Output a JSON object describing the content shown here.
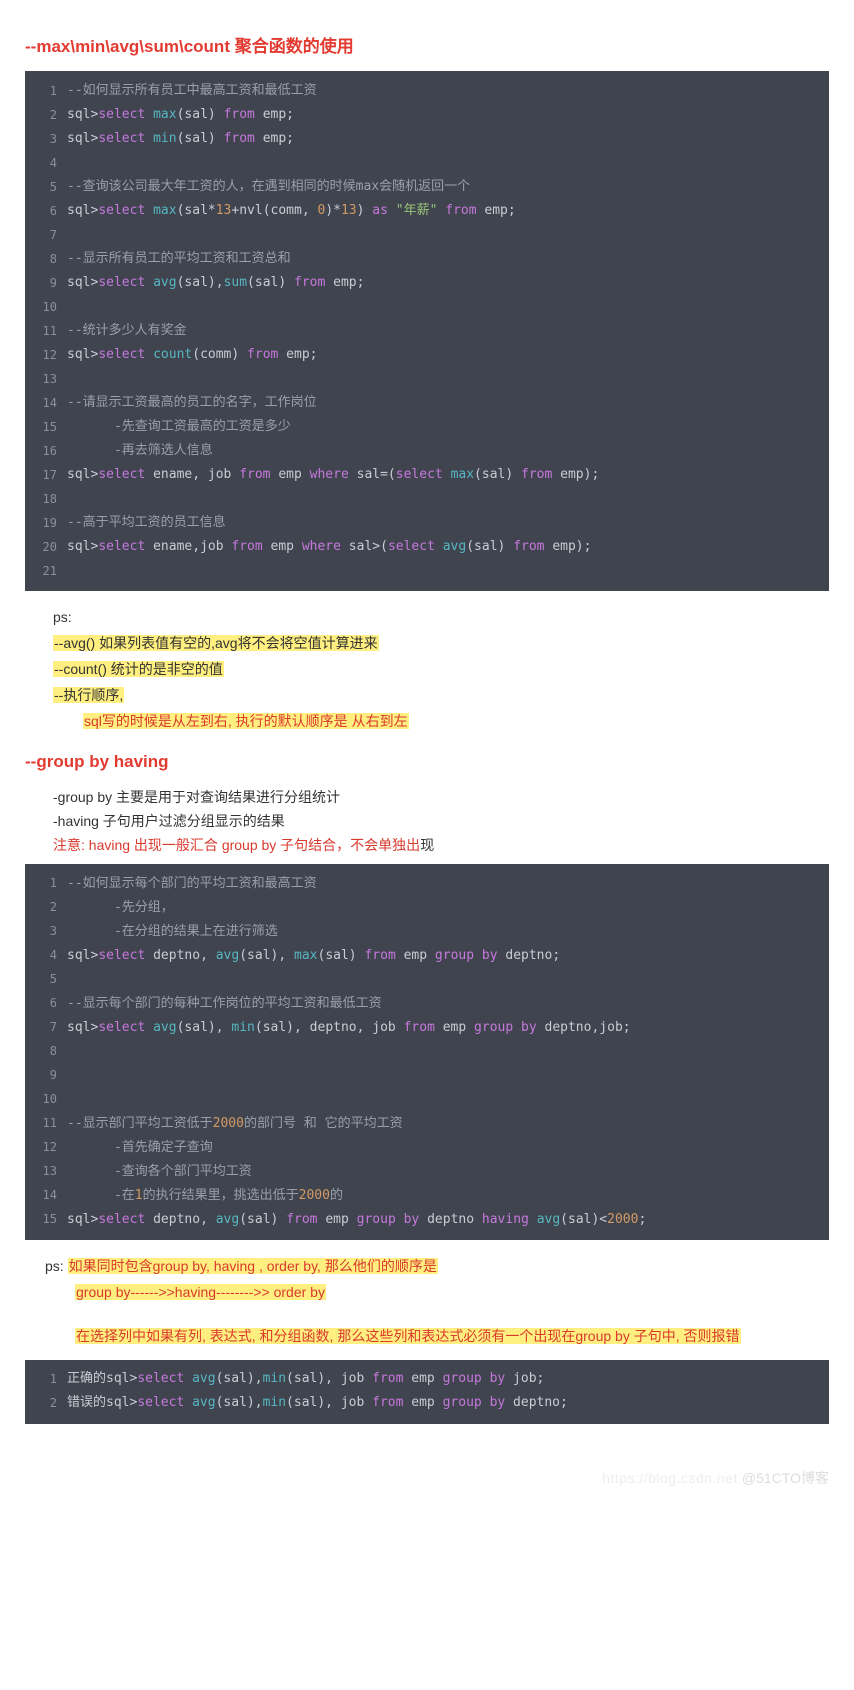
{
  "section1": {
    "title": "--max\\min\\avg\\sum\\count   聚合函数的使用",
    "code": [
      [
        {
          "t": "--如何显示所有员工中最高工资和最低工资",
          "c": "cmt"
        }
      ],
      [
        {
          "t": "sql>"
        },
        {
          "t": "select",
          "c": "kw"
        },
        {
          "t": " "
        },
        {
          "t": "max",
          "c": "fn"
        },
        {
          "t": "(sal) "
        },
        {
          "t": "from",
          "c": "kw"
        },
        {
          "t": " emp;"
        }
      ],
      [
        {
          "t": "sql>"
        },
        {
          "t": "select",
          "c": "kw"
        },
        {
          "t": " "
        },
        {
          "t": "min",
          "c": "fn"
        },
        {
          "t": "(sal) "
        },
        {
          "t": "from",
          "c": "kw"
        },
        {
          "t": " emp;"
        }
      ],
      [],
      [
        {
          "t": "--查询该公司最大年工资的人，在遇到相同的时候max会随机返回一个",
          "c": "cmt"
        }
      ],
      [
        {
          "t": "sql>"
        },
        {
          "t": "select",
          "c": "kw"
        },
        {
          "t": " "
        },
        {
          "t": "max",
          "c": "fn"
        },
        {
          "t": "(sal*"
        },
        {
          "t": "13",
          "c": "num"
        },
        {
          "t": "+nvl(comm, "
        },
        {
          "t": "0",
          "c": "num"
        },
        {
          "t": ")*"
        },
        {
          "t": "13",
          "c": "num"
        },
        {
          "t": ") "
        },
        {
          "t": "as",
          "c": "kw"
        },
        {
          "t": " "
        },
        {
          "t": "\"年薪\"",
          "c": "str"
        },
        {
          "t": " "
        },
        {
          "t": "from",
          "c": "kw"
        },
        {
          "t": " emp;"
        }
      ],
      [],
      [
        {
          "t": "--显示所有员工的平均工资和工资总和",
          "c": "cmt"
        }
      ],
      [
        {
          "t": "sql>"
        },
        {
          "t": "select",
          "c": "kw"
        },
        {
          "t": " "
        },
        {
          "t": "avg",
          "c": "fn"
        },
        {
          "t": "(sal),"
        },
        {
          "t": "sum",
          "c": "fn"
        },
        {
          "t": "(sal) "
        },
        {
          "t": "from",
          "c": "kw"
        },
        {
          "t": " emp;"
        }
      ],
      [],
      [
        {
          "t": "--统计多少人有奖金",
          "c": "cmt"
        }
      ],
      [
        {
          "t": "sql>"
        },
        {
          "t": "select",
          "c": "kw"
        },
        {
          "t": " "
        },
        {
          "t": "count",
          "c": "fn"
        },
        {
          "t": "(comm) "
        },
        {
          "t": "from",
          "c": "kw"
        },
        {
          "t": " emp;"
        }
      ],
      [],
      [
        {
          "t": "--请显示工资最高的员工的名字，工作岗位",
          "c": "cmt"
        }
      ],
      [
        {
          "t": "      -先查询工资最高的工资是多少",
          "c": "cmt"
        }
      ],
      [
        {
          "t": "      -再去筛选人信息",
          "c": "cmt"
        }
      ],
      [
        {
          "t": "sql>"
        },
        {
          "t": "select",
          "c": "kw"
        },
        {
          "t": " ename, job "
        },
        {
          "t": "from",
          "c": "kw"
        },
        {
          "t": " emp "
        },
        {
          "t": "where",
          "c": "kw"
        },
        {
          "t": " sal=("
        },
        {
          "t": "select",
          "c": "kw"
        },
        {
          "t": " "
        },
        {
          "t": "max",
          "c": "fn"
        },
        {
          "t": "(sal) "
        },
        {
          "t": "from",
          "c": "kw"
        },
        {
          "t": " emp);"
        }
      ],
      [],
      [
        {
          "t": "--高于平均工资的员工信息",
          "c": "cmt"
        }
      ],
      [
        {
          "t": "sql>"
        },
        {
          "t": "select",
          "c": "kw"
        },
        {
          "t": " ename,job "
        },
        {
          "t": "from",
          "c": "kw"
        },
        {
          "t": " emp "
        },
        {
          "t": "where",
          "c": "kw"
        },
        {
          "t": " sal>("
        },
        {
          "t": "select",
          "c": "kw"
        },
        {
          "t": " "
        },
        {
          "t": "avg",
          "c": "fn"
        },
        {
          "t": "(sal) "
        },
        {
          "t": "from",
          "c": "kw"
        },
        {
          "t": " emp);"
        }
      ],
      []
    ],
    "ps_label": "ps:",
    "notes": [
      "--avg() 如果列表值有空的,avg将不会将空值计算进来",
      "--count() 统计的是非空的值",
      "--执行顺序,",
      "sql写的时候是从左到右, 执行的默认顺序是 从右到左"
    ]
  },
  "section2": {
    "title": "--group by having",
    "intro1": "-group by 主要是用于对查询结果进行分组统计",
    "intro2": "-having  子句用户过滤分组显示的结果",
    "intro3a": "注意: having 出现一般汇合 group by 子句结合，不会单独出",
    "intro3b": "现",
    "code": [
      [
        {
          "t": "--如何显示每个部门的平均工资和最高工资",
          "c": "cmt"
        }
      ],
      [
        {
          "t": "      -先分组，",
          "c": "cmt"
        }
      ],
      [
        {
          "t": "      -在分组的结果上在进行筛选",
          "c": "cmt"
        }
      ],
      [
        {
          "t": "sql>"
        },
        {
          "t": "select",
          "c": "kw"
        },
        {
          "t": " deptno, "
        },
        {
          "t": "avg",
          "c": "fn"
        },
        {
          "t": "(sal), "
        },
        {
          "t": "max",
          "c": "fn"
        },
        {
          "t": "(sal) "
        },
        {
          "t": "from",
          "c": "kw"
        },
        {
          "t": " emp "
        },
        {
          "t": "group",
          "c": "kw"
        },
        {
          "t": " "
        },
        {
          "t": "by",
          "c": "kw"
        },
        {
          "t": " deptno;"
        }
      ],
      [],
      [
        {
          "t": "--显示每个部门的每种工作岗位的平均工资和最低工资",
          "c": "cmt"
        }
      ],
      [
        {
          "t": "sql>"
        },
        {
          "t": "select",
          "c": "kw"
        },
        {
          "t": " "
        },
        {
          "t": "avg",
          "c": "fn"
        },
        {
          "t": "(sal), "
        },
        {
          "t": "min",
          "c": "fn"
        },
        {
          "t": "(sal), deptno, job "
        },
        {
          "t": "from",
          "c": "kw"
        },
        {
          "t": " emp "
        },
        {
          "t": "group",
          "c": "kw"
        },
        {
          "t": " "
        },
        {
          "t": "by",
          "c": "kw"
        },
        {
          "t": " deptno,job;"
        }
      ],
      [],
      [],
      [],
      [
        {
          "t": "--显示部门平均工资低于",
          "c": "cmt"
        },
        {
          "t": "2000",
          "c": "num"
        },
        {
          "t": "的部门号 和 它的平均工资",
          "c": "cmt"
        }
      ],
      [
        {
          "t": "      -首先确定子查询",
          "c": "cmt"
        }
      ],
      [
        {
          "t": "      -查询各个部门平均工资",
          "c": "cmt"
        }
      ],
      [
        {
          "t": "      -在",
          "c": "cmt"
        },
        {
          "t": "1",
          "c": "num"
        },
        {
          "t": "的执行结果里，挑选出低于",
          "c": "cmt"
        },
        {
          "t": "2000",
          "c": "num"
        },
        {
          "t": "的",
          "c": "cmt"
        }
      ],
      [
        {
          "t": "sql>"
        },
        {
          "t": "select",
          "c": "kw"
        },
        {
          "t": " deptno, "
        },
        {
          "t": "avg",
          "c": "fn"
        },
        {
          "t": "(sal) "
        },
        {
          "t": "from",
          "c": "kw"
        },
        {
          "t": " emp "
        },
        {
          "t": "group",
          "c": "kw"
        },
        {
          "t": " "
        },
        {
          "t": "by",
          "c": "kw"
        },
        {
          "t": " deptno "
        },
        {
          "t": "having",
          "c": "kw"
        },
        {
          "t": " "
        },
        {
          "t": "avg",
          "c": "fn"
        },
        {
          "t": "(sal)<"
        },
        {
          "t": "2000",
          "c": "num"
        },
        {
          "t": ";"
        }
      ]
    ],
    "ps_label": "ps:",
    "ps1": "如果同时包含group by, having , order by,  那么他们的顺序是",
    "ps2": "group by------>>having-------->> order by",
    "ps3": "在选择列中如果有列, 表达式, 和分组函数, 那么这些列和表达式必须有一个出现在group by 子句中, 否则报错",
    "code2": [
      [
        {
          "t": "正确的sql>"
        },
        {
          "t": "select",
          "c": "kw"
        },
        {
          "t": " "
        },
        {
          "t": "avg",
          "c": "fn"
        },
        {
          "t": "(sal),"
        },
        {
          "t": "min",
          "c": "fn"
        },
        {
          "t": "(sal), job "
        },
        {
          "t": "from",
          "c": "kw"
        },
        {
          "t": " emp "
        },
        {
          "t": "group",
          "c": "kw"
        },
        {
          "t": " "
        },
        {
          "t": "by",
          "c": "kw"
        },
        {
          "t": " job;"
        }
      ],
      [
        {
          "t": "错误的sql>"
        },
        {
          "t": "select",
          "c": "kw"
        },
        {
          "t": " "
        },
        {
          "t": "avg",
          "c": "fn"
        },
        {
          "t": "(sal),"
        },
        {
          "t": "min",
          "c": "fn"
        },
        {
          "t": "(sal), job "
        },
        {
          "t": "from",
          "c": "kw"
        },
        {
          "t": " emp "
        },
        {
          "t": "group",
          "c": "kw"
        },
        {
          "t": " "
        },
        {
          "t": "by",
          "c": "kw"
        },
        {
          "t": " deptno;"
        }
      ]
    ]
  },
  "watermark": {
    "faint": "https://blog.csdn.net",
    "text": "@51CTO博客"
  }
}
